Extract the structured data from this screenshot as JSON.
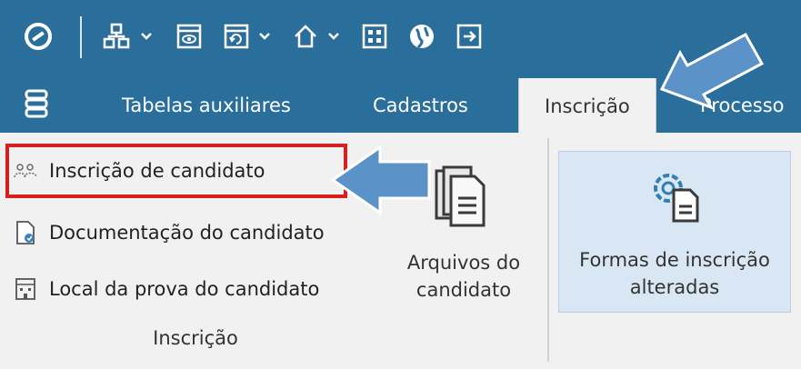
{
  "toolbar": {
    "icons": [
      "power-icon",
      "network-icon",
      "chevron-down-icon",
      "eye-window-icon",
      "refresh-window-icon",
      "chevron-down-icon",
      "home-icon",
      "chevron-down-icon",
      "grid-icon",
      "globe-icon",
      "exit-icon"
    ]
  },
  "tabs": [
    {
      "label": "Tabelas auxiliares"
    },
    {
      "label": "Cadastros"
    },
    {
      "label": "Inscrição"
    },
    {
      "label": "Processo"
    }
  ],
  "ribbon": {
    "group_inscricao": {
      "items": [
        {
          "label": "Inscrição de candidato",
          "icon": "users-icon"
        },
        {
          "label": "Documentação do candidato",
          "icon": "document-icon"
        },
        {
          "label": "Local da prova do candidato",
          "icon": "building-icon"
        }
      ],
      "big_button": {
        "label_line1": "Arquivos do",
        "label_line2": "candidato",
        "icon": "files-icon"
      },
      "label": "Inscrição"
    },
    "formas_button": {
      "label_line1": "Formas de inscrição",
      "label_line2": "alteradas",
      "icon": "gear-document-icon"
    }
  },
  "colors": {
    "toolbar_bg": "#2a6f9c",
    "ribbon_bg": "#f1f1f1",
    "highlight_border": "#d81e1e",
    "arrow_fill": "#5b93c9",
    "selected_button_bg": "#d9e7f5"
  }
}
